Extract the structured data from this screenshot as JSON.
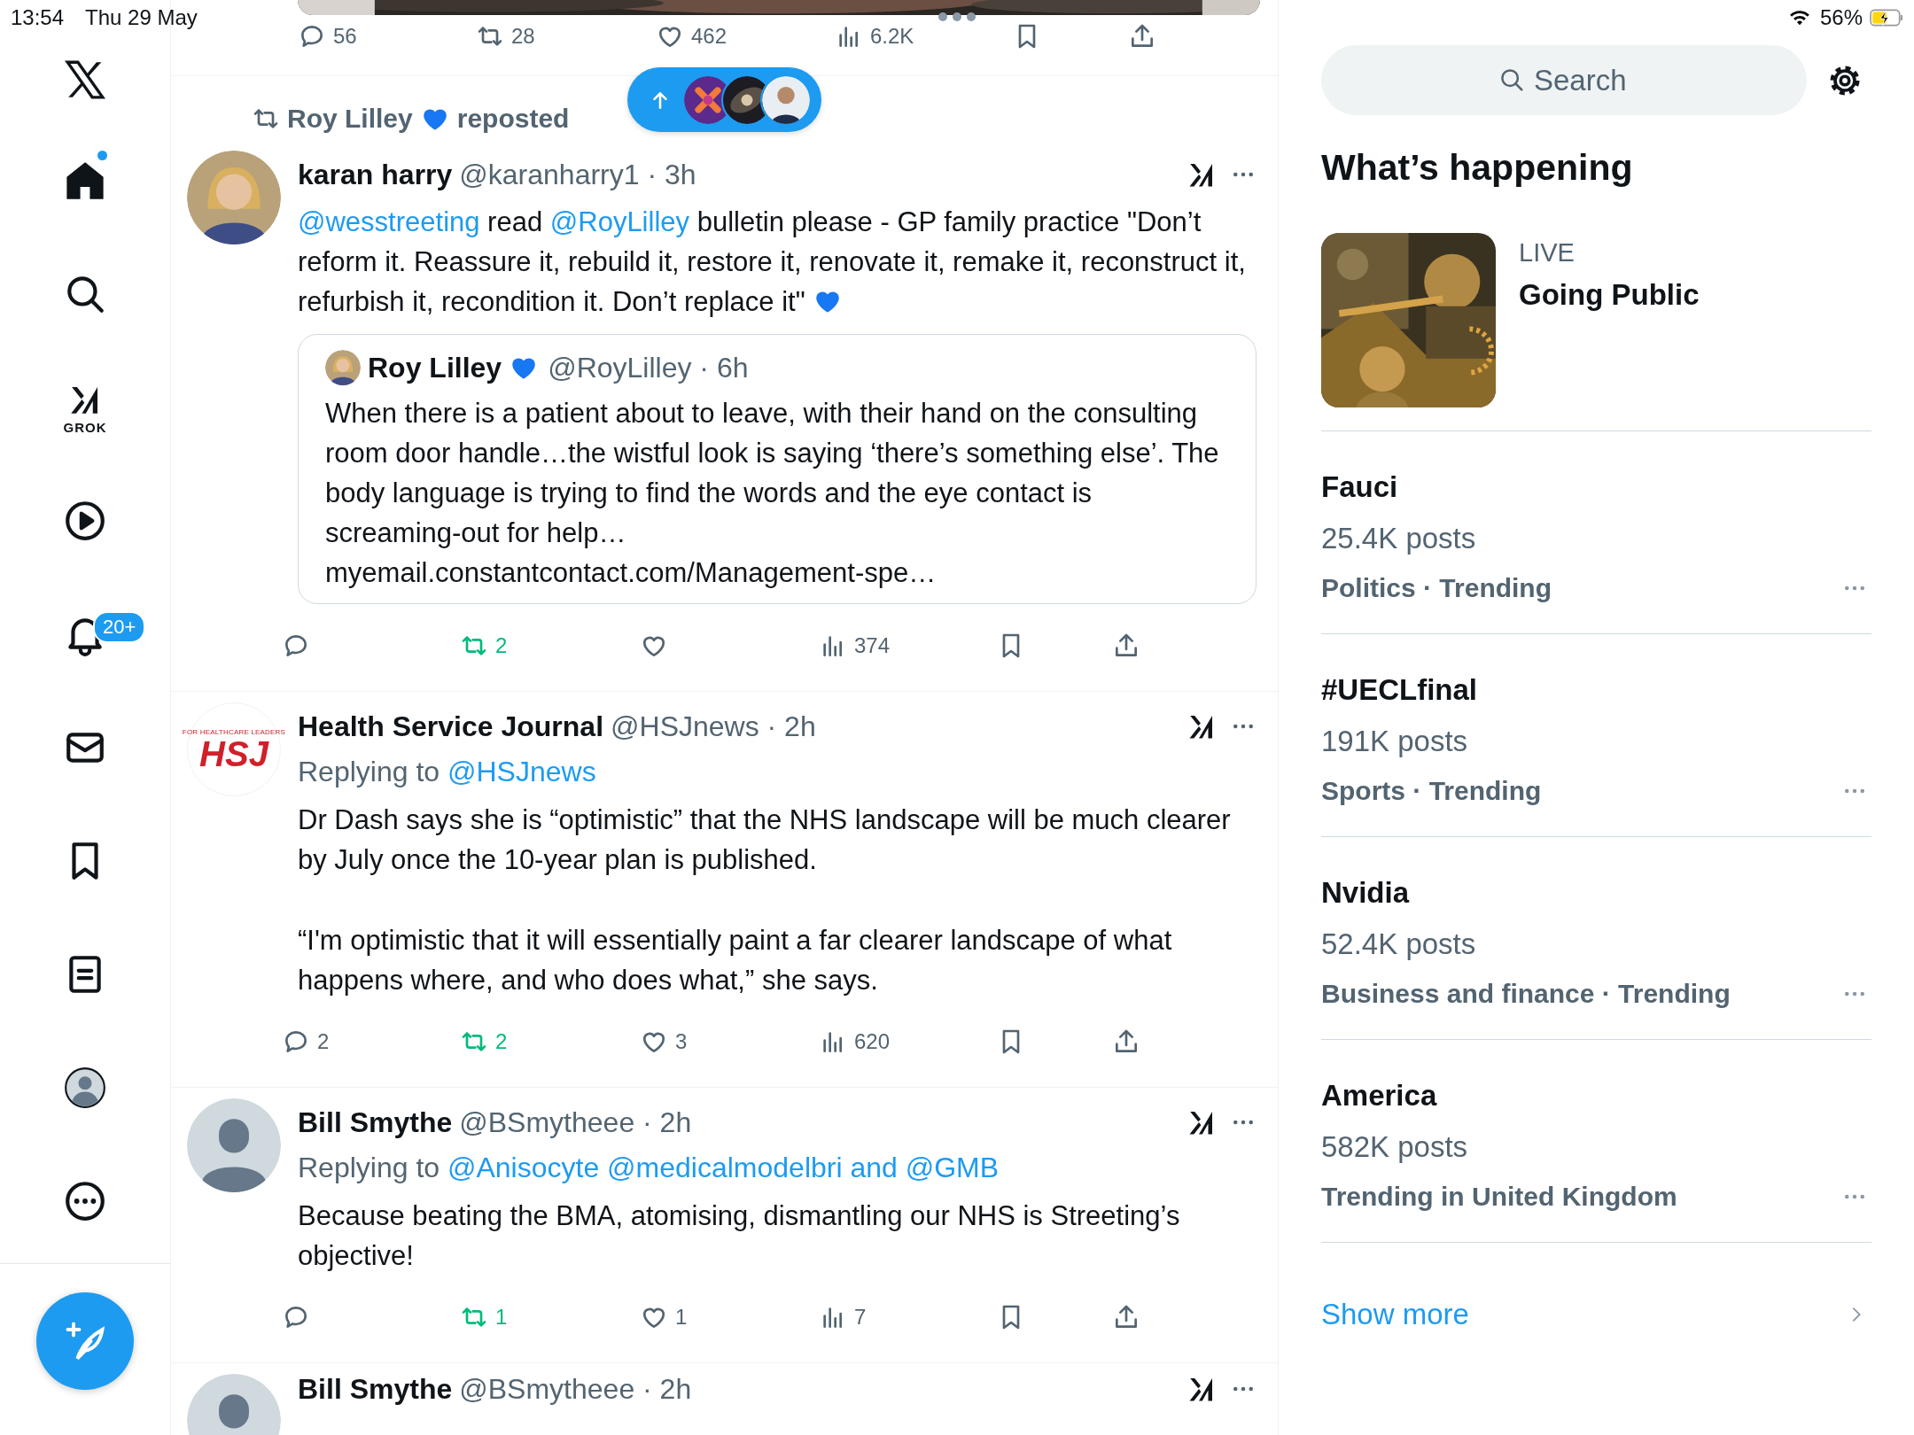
{
  "status_bar": {
    "time": "13:54",
    "date": "Thu 29 May",
    "battery": "56%",
    "charging": true
  },
  "nav": {
    "items": [
      {
        "kind": "logo",
        "selected": false
      },
      {
        "kind": "home",
        "selected": true,
        "unread": true
      },
      {
        "kind": "search",
        "selected": false
      },
      {
        "kind": "grok",
        "selected": false,
        "label": "GROK"
      },
      {
        "kind": "video",
        "selected": false
      },
      {
        "kind": "notifications",
        "selected": false,
        "badge": "20+"
      },
      {
        "kind": "messages",
        "selected": false
      },
      {
        "kind": "bookmarks",
        "selected": false
      },
      {
        "kind": "lists",
        "selected": false
      },
      {
        "kind": "profile",
        "selected": false
      },
      {
        "kind": "more",
        "selected": false
      }
    ],
    "compose": {
      "kind": "compose"
    }
  },
  "feed": {
    "posts": [
      {
        "kind": "media_tail",
        "actions": [
          {
            "kind": "reply",
            "count": "56"
          },
          {
            "kind": "repost",
            "count": "28",
            "active": false
          },
          {
            "kind": "like",
            "count": "462",
            "active": false
          },
          {
            "kind": "views",
            "count": "6.2K"
          },
          {
            "kind": "bookmark",
            "active": false
          },
          {
            "kind": "share"
          }
        ]
      },
      {
        "kind": "post",
        "repost_by": {
          "name": "Roy Lilley",
          "heart": true,
          "label": "reposted"
        },
        "author": {
          "name": "karan harry",
          "meta": "@karanharry1 · 3h"
        },
        "text": [
          [
            {
              "kind": "mention",
              "text": "@wesstreeting"
            },
            {
              "kind": "plain",
              "text": " read "
            },
            {
              "kind": "mention",
              "text": "@RoyLilley"
            },
            {
              "kind": "plain",
              "text": " bulletin please - GP family practice \"Don’t reform it. Reassure it, rebuild it, restore it, renovate it, remake it, reconstruct it, refurbish it, recondition it. Don’t replace it\" "
            },
            {
              "kind": "heart"
            }
          ]
        ],
        "quote": {
          "author": {
            "name": "Roy Lilley",
            "heart": true,
            "meta": "@RoyLilley · 6h"
          },
          "text": [
            [
              {
                "kind": "plain",
                "text": "When there is a patient about to leave, with their hand on the consulting room door handle…the wistful look is saying ‘there’s something else’. The body language is trying to find the words and the eye contact is screaming-out for help… "
              },
              {
                "kind": "url",
                "text": "myemail.constantcontact.com/Management-spe…"
              }
            ]
          ]
        },
        "actions": [
          {
            "kind": "reply"
          },
          {
            "kind": "repost",
            "count": "2",
            "active": true
          },
          {
            "kind": "like",
            "active": false
          },
          {
            "kind": "views",
            "count": "374"
          },
          {
            "kind": "bookmark",
            "active": false
          },
          {
            "kind": "share"
          }
        ]
      },
      {
        "kind": "post",
        "author": {
          "name": "Health Service Journal",
          "meta": "@HSJnews · 2h",
          "avatar": {
            "kind": "logo",
            "text": "HSJ",
            "tagline": "FOR HEALTHCARE LEADERS"
          }
        },
        "replying_to": {
          "label": "Replying to",
          "mentions": "@HSJnews"
        },
        "text": [
          [
            {
              "kind": "plain",
              "text": "Dr Dash says she is “optimistic” that the NHS landscape will be much clearer by July once the 10-year plan is published."
            }
          ],
          [
            {
              "kind": "plain",
              "text": "“I'm optimistic that it will essentially paint a far clearer landscape of what happens where, and who does what,” she says."
            }
          ]
        ],
        "actions": [
          {
            "kind": "reply",
            "count": "2"
          },
          {
            "kind": "repost",
            "count": "2",
            "active": true
          },
          {
            "kind": "like",
            "count": "3",
            "active": false
          },
          {
            "kind": "views",
            "count": "620"
          },
          {
            "kind": "bookmark",
            "active": false
          },
          {
            "kind": "share"
          }
        ]
      },
      {
        "kind": "post",
        "author": {
          "name": "Bill Smythe",
          "meta": "@BSmytheee · 2h",
          "avatar": {
            "kind": "default"
          }
        },
        "replying_to": {
          "label": "Replying to",
          "mentions": "@Anisocyte @medicalmodelbri and @GMB"
        },
        "text": [
          [
            {
              "kind": "plain",
              "text": "Because beating the BMA, atomising, dismantling our NHS is Streeting’s objective!"
            }
          ]
        ],
        "actions": [
          {
            "kind": "reply"
          },
          {
            "kind": "repost",
            "count": "1",
            "active": true
          },
          {
            "kind": "like",
            "count": "1",
            "active": false
          },
          {
            "kind": "views",
            "count": "7"
          },
          {
            "kind": "bookmark",
            "active": false
          },
          {
            "kind": "share"
          }
        ]
      },
      {
        "kind": "post",
        "author": {
          "name": "Bill Smythe",
          "meta": "@BSmytheee · 2h",
          "avatar": {
            "kind": "default"
          }
        }
      }
    ]
  },
  "sidebar": {
    "search": {
      "placeholder": "Search"
    },
    "heading": "What’s happening",
    "live": {
      "label": "LIVE",
      "title": "Going Public"
    },
    "trends": [
      {
        "name": "Fauci",
        "posts": "25.4K posts",
        "category": "Politics · Trending"
      },
      {
        "name": "#UECLfinal",
        "posts": "191K posts",
        "category": "Sports · Trending"
      },
      {
        "name": "Nvidia",
        "posts": "52.4K posts",
        "category": "Business and finance · Trending"
      },
      {
        "name": "America",
        "posts": "582K posts",
        "category": "Trending in United Kingdom"
      }
    ],
    "show_more": "Show more"
  }
}
